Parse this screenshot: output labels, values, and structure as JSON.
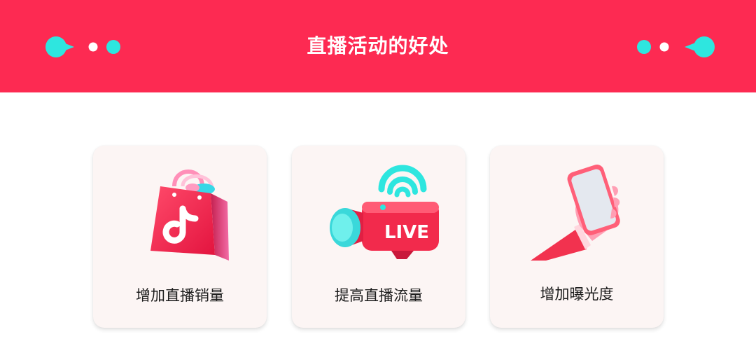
{
  "header": {
    "title": "直播活动的好处"
  },
  "cards": [
    {
      "label": "增加直播销量",
      "icon": "shopping-bag-icon"
    },
    {
      "label": "提高直播流量",
      "icon": "live-camera-icon",
      "badge": "LIVE"
    },
    {
      "label": "增加曝光度",
      "icon": "hand-phone-icon"
    }
  ],
  "colors": {
    "banner": "#fd2a52",
    "accent_cyan": "#2ee6df",
    "card_bg": "#fcf5f4"
  }
}
